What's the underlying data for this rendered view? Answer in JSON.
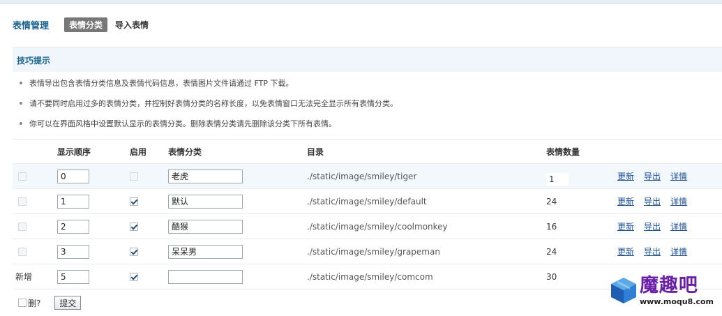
{
  "header": {
    "title": "表情管理",
    "tabs": [
      {
        "label": "表情分类",
        "active": true
      },
      {
        "label": "导入表情",
        "active": false
      }
    ]
  },
  "tips": {
    "title": "技巧提示",
    "items": [
      "表情导出包含表情分类信息及表情代码信息，表情图片文件请通过 FTP 下载。",
      "请不要同时启用过多的表情分类，并控制好表情分类的名称长度，以免表情窗口无法完全显示所有表情分类。",
      "你可以在界面风格中设置默认显示的表情分类。删除表情分类请先删除该分类下所有表情。"
    ]
  },
  "table": {
    "headers": {
      "order": "显示顺序",
      "enabled": "启用",
      "category": "表情分类",
      "dir": "目录",
      "count": "表情数量"
    },
    "rows": [
      {
        "order": "0",
        "enabled": false,
        "name": "老虎",
        "dir": "./static/image/smiley/tiger",
        "count": "1",
        "ops": [
          "更新",
          "导出",
          "详情"
        ]
      },
      {
        "order": "1",
        "enabled": true,
        "name": "默认",
        "dir": "./static/image/smiley/default",
        "count": "24",
        "ops": [
          "更新",
          "导出",
          "详情"
        ]
      },
      {
        "order": "2",
        "enabled": true,
        "name": "酷猴",
        "dir": "./static/image/smiley/coolmonkey",
        "count": "16",
        "ops": [
          "更新",
          "导出",
          "详情"
        ]
      },
      {
        "order": "3",
        "enabled": true,
        "name": "呆呆男",
        "dir": "./static/image/smiley/grapeman",
        "count": "24",
        "ops": [
          "更新",
          "导出",
          "详情"
        ]
      }
    ],
    "new_row": {
      "label": "新增",
      "order": "5",
      "enabled": true,
      "name": "",
      "dir": "./static/image/smiley/comcom",
      "count": "30"
    }
  },
  "footer": {
    "delete_label": "删?",
    "submit_label": "提交"
  },
  "watermark": {
    "cn": "魔趣吧",
    "url": "www.moqu8.com"
  },
  "colors": {
    "accent": "#14628d",
    "link": "#1b4f93",
    "tip_bg": "#f0f6fb",
    "logo_purple": "#6b1fa8"
  }
}
